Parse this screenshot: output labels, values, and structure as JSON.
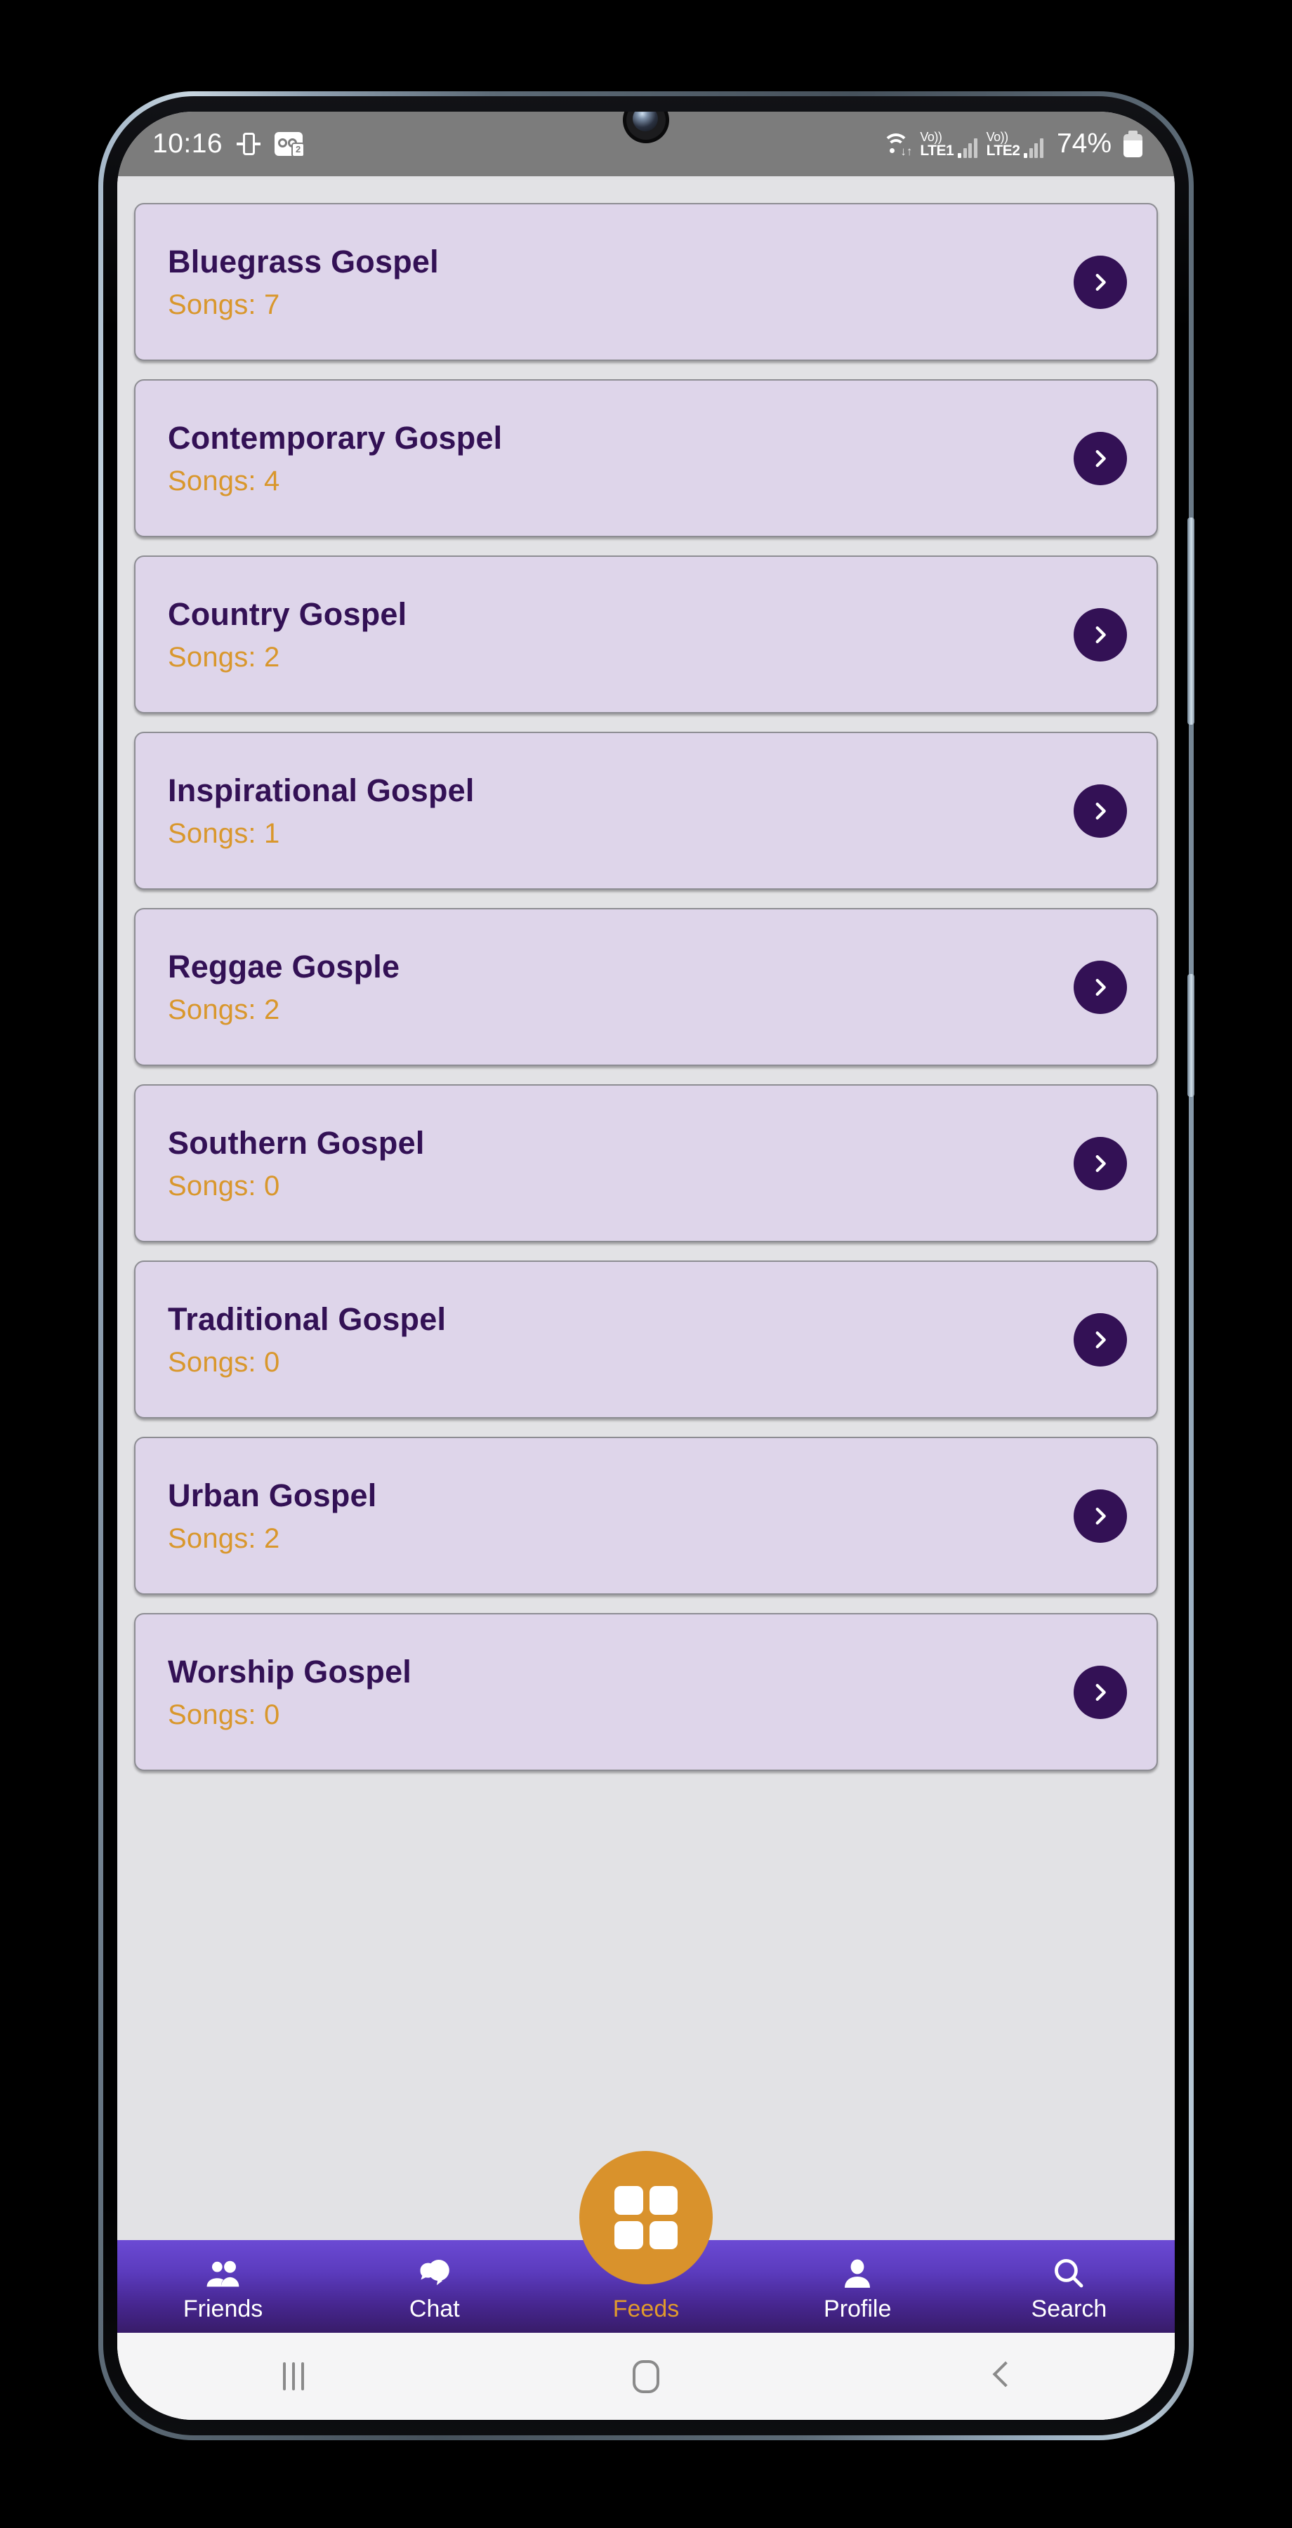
{
  "status_bar": {
    "time": "10:16",
    "rotation_icon": "screen-rotation-icon",
    "voicemail_icon": "voicemail-icon",
    "voicemail_badge": "2",
    "wifi_icon": "wifi-icon",
    "wifi_transfer": "↓↑",
    "sim1_vo": "Vo))",
    "sim1_lte": "LTE1",
    "sim2_vo": "Vo))",
    "sim2_lte": "LTE2",
    "battery_percent": "74%",
    "battery_icon": "battery-icon",
    "background_color": "#7c7c7c"
  },
  "colors": {
    "card_bg": "#ded5ea",
    "card_border": "#8d8d93",
    "title": "#331155",
    "accent_orange": "#d9972c",
    "nav_top": "#6b4ad4",
    "nav_bottom": "#381c69",
    "screen_bg": "#e2e2e5",
    "fab": "#d9922c"
  },
  "list": {
    "chevron_icon": "chevron-right-icon",
    "songs_label": "Songs:",
    "items": [
      {
        "title": "Bluegrass Gospel",
        "songs": "Songs: 7",
        "count": 7
      },
      {
        "title": "Contemporary Gospel",
        "songs": "Songs: 4",
        "count": 4
      },
      {
        "title": "Country Gospel",
        "songs": "Songs: 2",
        "count": 2
      },
      {
        "title": "Inspirational Gospel",
        "songs": "Songs: 1",
        "count": 1
      },
      {
        "title": "Reggae Gosple",
        "songs": "Songs: 2",
        "count": 2
      },
      {
        "title": "Southern Gospel",
        "songs": "Songs: 0",
        "count": 0
      },
      {
        "title": "Traditional Gospel",
        "songs": "Songs: 0",
        "count": 0
      },
      {
        "title": "Urban Gospel",
        "songs": "Songs: 2",
        "count": 2
      },
      {
        "title": "Worship Gospel",
        "songs": "Songs: 0",
        "count": 0
      }
    ]
  },
  "bottom_nav": {
    "active": "Feeds",
    "items": [
      {
        "label": "Friends",
        "icon": "people-icon"
      },
      {
        "label": "Chat",
        "icon": "chat-bubbles-icon"
      },
      {
        "label": "Feeds",
        "icon": "grid-squares-icon"
      },
      {
        "label": "Profile",
        "icon": "person-icon"
      },
      {
        "label": "Search",
        "icon": "search-icon"
      }
    ]
  },
  "fab": {
    "icon": "grid-squares-icon"
  },
  "android_nav": {
    "recents": "recents-icon",
    "home": "home-icon",
    "back": "back-icon"
  }
}
